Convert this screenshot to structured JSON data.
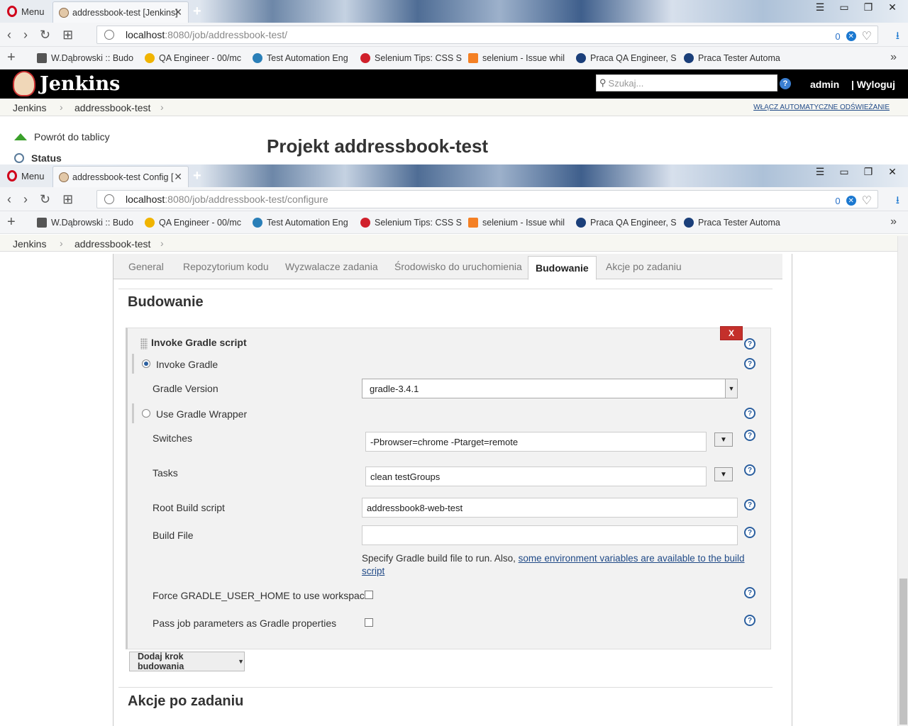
{
  "back_window": {
    "menu_label": "Menu",
    "tab_title": "addressbook-test [Jenkins]",
    "url_host": "localhost",
    "url_path": ":8080/job/addressbook-test/",
    "block_count": "0",
    "bookmarks": [
      "W.Dąbrowski :: Budo",
      "QA Engineer - 00/mc",
      "Test Automation Eng",
      "Selenium Tips: CSS S",
      "selenium - Issue whil",
      "Praca QA Engineer, S",
      "Praca Tester Automa"
    ],
    "jenkins": {
      "title": "Jenkins",
      "search_placeholder": "Szukaj...",
      "help": "?",
      "user": "admin",
      "logout": "| Wyloguj",
      "crumb_home": "Jenkins",
      "crumb_job": "addressbook-test",
      "auto_refresh": "WŁĄCZ AUTOMATYCZNE ODŚWIEŻANIE",
      "back_link": "Powrót do tablicy",
      "status_link": "Status",
      "project_title": "Projekt addressbook-test"
    }
  },
  "front_window": {
    "menu_label": "Menu",
    "tab_title": "addressbook-test Config [",
    "url_host": "localhost",
    "url_path": ":8080/job/addressbook-test/configure",
    "block_count": "0",
    "bookmarks": [
      "W.Dąbrowski :: Budo",
      "QA Engineer - 00/mc",
      "Test Automation Eng",
      "Selenium Tips: CSS S",
      "selenium - Issue whil",
      "Praca QA Engineer, S",
      "Praca Tester Automa"
    ],
    "crumb_home": "Jenkins",
    "crumb_job": "addressbook-test"
  },
  "config": {
    "tabs": [
      "General",
      "Repozytorium kodu",
      "Wyzwalacze zadania",
      "Środowisko do uruchomienia",
      "Budowanie",
      "Akcje po zadaniu"
    ],
    "active_tab": "Budowanie",
    "section_build": "Budowanie",
    "step_title": "Invoke Gradle script",
    "remove_label": "X",
    "invoke_gradle_label": "Invoke Gradle",
    "invoke_gradle_selected": true,
    "gradle_version_label": "Gradle Version",
    "gradle_version_value": "gradle-3.4.1",
    "use_wrapper_label": "Use Gradle Wrapper",
    "use_wrapper_selected": false,
    "switches_label": "Switches",
    "switches_value": "-Pbrowser=chrome -Ptarget=remote",
    "tasks_label": "Tasks",
    "tasks_value": "clean testGroups",
    "root_build_label": "Root Build script",
    "root_build_value": "addressbook8-web-test",
    "build_file_label": "Build File",
    "build_file_value": "",
    "build_file_desc": "Specify Gradle build file to run. Also, ",
    "build_file_link": "some environment variables are available to the build script",
    "force_home_label": "Force GRADLE_USER_HOME to use workspace",
    "force_home_checked": false,
    "pass_params_label": "Pass job parameters as Gradle properties",
    "pass_params_checked": false,
    "add_step_label": "Dodaj krok budowania",
    "section_post": "Akcje po zadaniu",
    "help": "?"
  },
  "icons": [
    "opera-logo-icon",
    "jenkins-favicon-icon",
    "close-icon",
    "new-tab-icon",
    "back-icon",
    "forward-icon",
    "reload-icon",
    "speed-dial-icon",
    "globe-icon",
    "adblock-icon",
    "heart-icon",
    "download-icon",
    "jenkins-butler-icon",
    "search-icon",
    "help-icon",
    "up-arrow-icon",
    "magnifier-icon",
    "drag-handle-icon",
    "dropdown-arrow-icon"
  ],
  "colors": {
    "jenkins_header": "#000000",
    "remove_button": "#c4302b",
    "help_icon": "#2b5f9f",
    "link": "#204a87",
    "opera_red": "#d0021b"
  }
}
